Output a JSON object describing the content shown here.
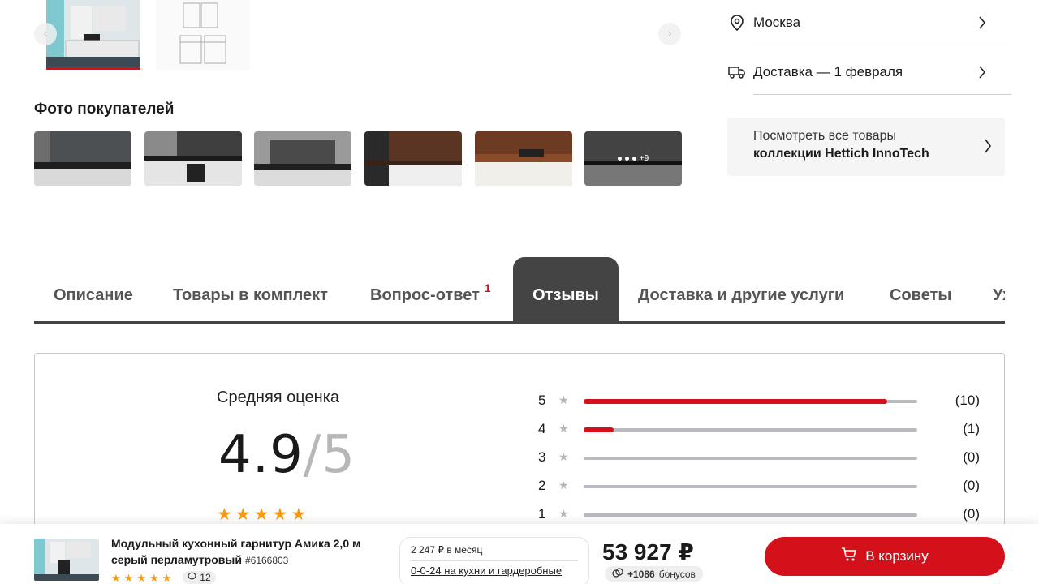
{
  "gallery": {
    "thumbs": [
      {
        "icon": "kitchen-photo",
        "active": true
      },
      {
        "icon": "kitchen-drawing",
        "active": false
      }
    ]
  },
  "buyer_photos": {
    "title": "Фото покупателей",
    "more_label": "+9"
  },
  "location": {
    "city": "Москва",
    "delivery": "Доставка — 1 февраля"
  },
  "collection": {
    "line1": "Посмотреть все товары",
    "line2": "коллекции Hettich InnoTech"
  },
  "tabs": [
    {
      "label": "Описание"
    },
    {
      "label": "Товары в комплект"
    },
    {
      "label": "Вопрос-ответ",
      "badge": "1"
    },
    {
      "label": "Отзывы",
      "active": true
    },
    {
      "label": "Доставка и другие услуги"
    },
    {
      "label": "Советы"
    },
    {
      "label": "Уход"
    }
  ],
  "reviews": {
    "avg_label": "Средняя оценка",
    "avg_value": "4.9",
    "avg_max": "/5",
    "stars": 5,
    "rows": [
      {
        "stars": "5",
        "count": "(10)",
        "fraction": 0.91
      },
      {
        "stars": "4",
        "count": "(1)",
        "fraction": 0.09
      },
      {
        "stars": "3",
        "count": "(0)",
        "fraction": 0
      },
      {
        "stars": "2",
        "count": "(0)",
        "fraction": 0
      },
      {
        "stars": "1",
        "count": "(0)",
        "fraction": 0
      }
    ]
  },
  "sticky": {
    "product_name": "Модульный кухонный гарнитур Амика 2,0 м серый перламутровый",
    "sku": "#6166803",
    "review_count": "12",
    "installment_line1": "2 247 ₽ в месяц",
    "installment_line2": "0-0-24 на кухни и гардеробные",
    "price": "53 927 ₽",
    "bonus_amount": "+1086",
    "bonus_label": "бонусов",
    "cart_label": "В корзину"
  },
  "colors": {
    "accent": "#d4111b",
    "tab_active": "#444444",
    "star": "#f59a16"
  }
}
